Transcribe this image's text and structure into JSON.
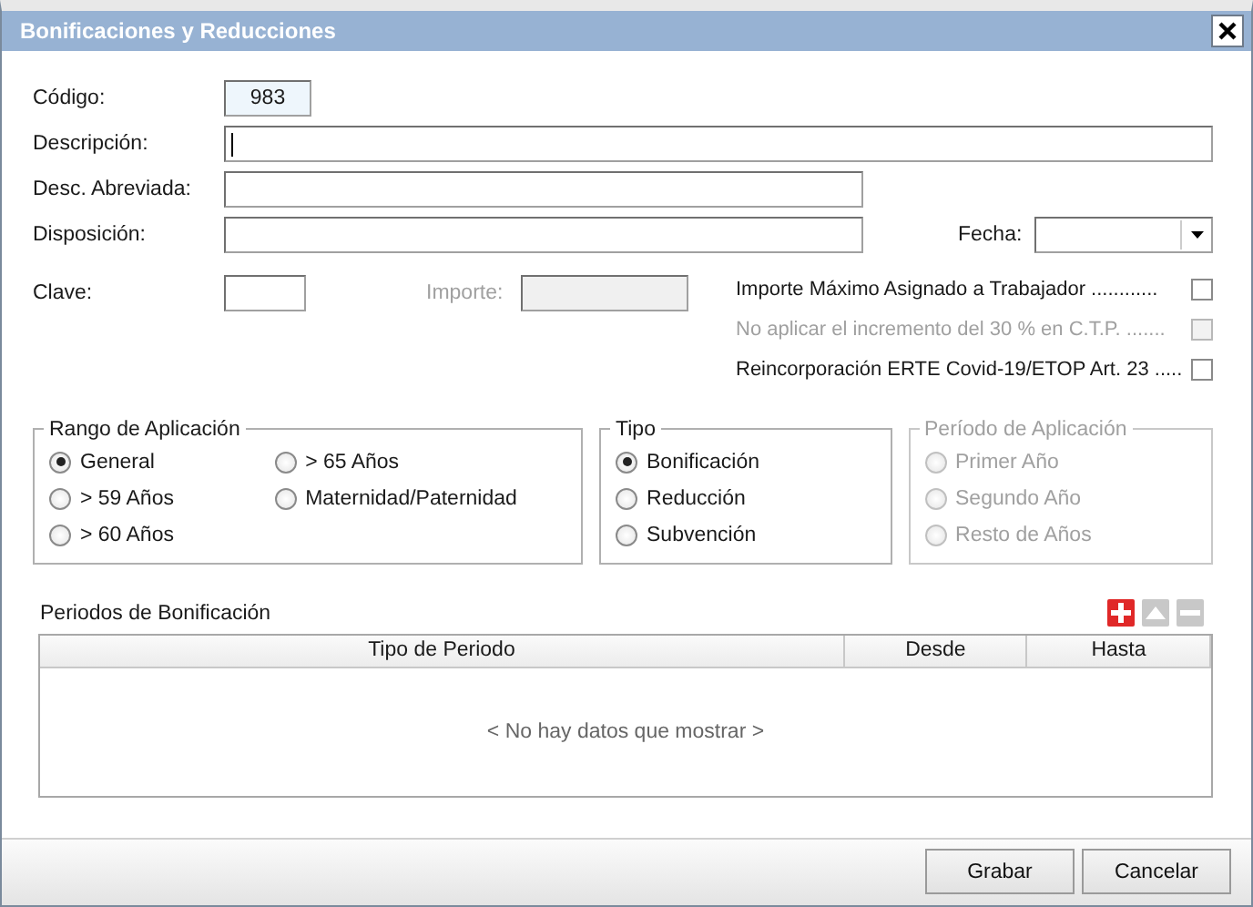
{
  "window": {
    "title": "Bonificaciones y Reducciones"
  },
  "codigo": {
    "label": "Código:",
    "value": "983"
  },
  "descripcion": {
    "label": "Descripción:",
    "focused": true
  },
  "desc_abreviada": {
    "label": "Desc. Abreviada:"
  },
  "disposicion": {
    "label": "Disposición:"
  },
  "fecha": {
    "label": "Fecha:"
  },
  "clave": {
    "label": "Clave:"
  },
  "importe": {
    "label": "Importe:",
    "disabled": true
  },
  "options": [
    {
      "label": "Importe Máximo Asignado a Trabajador ............",
      "checked": false,
      "disabled": false
    },
    {
      "label": "No aplicar el incremento del 30 % en C.T.P. .......",
      "checked": false,
      "disabled": true
    },
    {
      "label": "Reincorporación ERTE Covid-19/ETOP Art. 23 .....",
      "checked": false,
      "disabled": false
    }
  ],
  "groups": [
    {
      "title": "Rango de Aplicación",
      "disabled": false,
      "items": [
        {
          "label": "General",
          "selected": true
        },
        {
          "label": "> 59 Años",
          "selected": false
        },
        {
          "label": "> 60 Años",
          "selected": false
        },
        {
          "label": "> 65 Años",
          "selected": false
        },
        {
          "label": "Maternidad/Paternidad",
          "selected": false
        }
      ]
    },
    {
      "title": "Tipo",
      "disabled": false,
      "items": [
        {
          "label": "Bonificación",
          "selected": true
        },
        {
          "label": "Reducción",
          "selected": false
        },
        {
          "label": "Subvención",
          "selected": false
        }
      ]
    },
    {
      "title": "Período de Aplicación",
      "disabled": true,
      "items": [
        {
          "label": "Primer Año",
          "selected": false
        },
        {
          "label": "Segundo Año",
          "selected": false
        },
        {
          "label": "Resto de Años",
          "selected": false
        }
      ]
    }
  ],
  "periodos": {
    "title": "Periodos de Bonificación",
    "tools": [
      {
        "kind": "add",
        "disabled": false
      },
      {
        "kind": "up",
        "disabled": true
      },
      {
        "kind": "remove",
        "disabled": true
      }
    ],
    "columns": [
      "Tipo de Periodo",
      "Desde",
      "Hasta"
    ],
    "empty_text": "< No hay datos que mostrar >"
  },
  "buttons": [
    "Grabar",
    "Cancelar"
  ]
}
